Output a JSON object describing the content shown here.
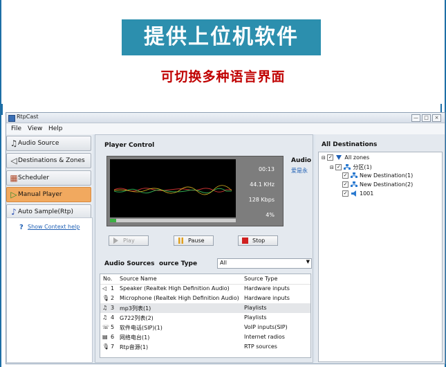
{
  "banner": {
    "title": "提供上位机软件",
    "subtitle": "可切换多种语言界面"
  },
  "window": {
    "title": "RtpCast",
    "controls": [
      "—",
      "□",
      "×"
    ]
  },
  "menu": [
    "File",
    "View",
    "Help"
  ],
  "sidebar": {
    "items": [
      {
        "label": "Audio Source",
        "icon": "music-note-icon"
      },
      {
        "label": "Destinations & Zones",
        "icon": "speaker-icon"
      },
      {
        "label": "Scheduler",
        "icon": "calendar-icon"
      },
      {
        "label": "Manual Player",
        "icon": "play-icon",
        "active": true
      },
      {
        "label": "Auto Sample(Rtp)",
        "icon": "music-note-icon"
      }
    ],
    "help_link": "Show Context help"
  },
  "player": {
    "header": "Player Control",
    "time": "00:13",
    "sample_rate": "44.1 KHz",
    "bitrate": "128 Kbps",
    "percent": "4%",
    "progress": 0.05,
    "audio_label": "Audio",
    "audio_track": "爱是永",
    "buttons": {
      "play": "Play",
      "pause": "Pause",
      "stop": "Stop"
    }
  },
  "sources": {
    "header": "Audio Sources",
    "type_label": "ource Type",
    "type_value": "All",
    "columns": [
      "No.",
      "Source Name",
      "Source Type"
    ],
    "rows": [
      {
        "no": "1",
        "name": "Speaker (Realtek High Definition Audio)",
        "type": "Hardware inputs",
        "icon": "speaker-icon"
      },
      {
        "no": "2",
        "name": "Microphone (Realtek High Definition Audio)",
        "type": "Hardware inputs",
        "icon": "microphone-icon"
      },
      {
        "no": "3",
        "name": "mp3列表(1)",
        "type": "Playlists",
        "icon": "playlist-icon"
      },
      {
        "no": "4",
        "name": "G722列表(2)",
        "type": "Playlists",
        "icon": "playlist-icon"
      },
      {
        "no": "5",
        "name": "软件电话(SIP)(1)",
        "type": "VoIP inputs(SIP)",
        "icon": "phone-icon"
      },
      {
        "no": "6",
        "name": "网络电台(1)",
        "type": "Internet radios",
        "icon": "radio-icon"
      },
      {
        "no": "7",
        "name": "Rtp音源(1)",
        "type": "RTP sources",
        "icon": "microphone-icon"
      }
    ]
  },
  "destinations": {
    "header": "All Destinations",
    "tree": [
      {
        "label": "All zones",
        "level": 0
      },
      {
        "label": "分区(1)",
        "level": 1
      },
      {
        "label": "New Destination(1)",
        "level": 2
      },
      {
        "label": "New Destination(2)",
        "level": 2
      },
      {
        "label": "1001",
        "level": 2
      }
    ]
  },
  "colors": {
    "accent": "#2c8fae",
    "subtitle": "#c00000",
    "active_nav": "#f1a95f",
    "link": "#1e5fb4"
  }
}
